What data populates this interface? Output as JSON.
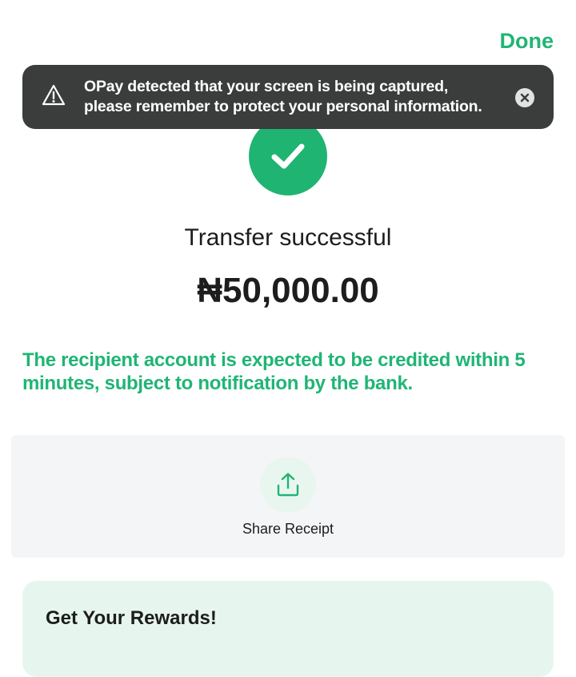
{
  "header": {
    "done_label": "Done"
  },
  "toast": {
    "icon": "warning-triangle-icon",
    "line1": "OPay detected that your screen is being captured,",
    "line2": "please remember to protect your personal information.",
    "close_icon": "close-circle-icon"
  },
  "status": {
    "icon": "checkmark-icon",
    "title": "Transfer successful",
    "amount": "₦50,000.00"
  },
  "notice": {
    "text": "The recipient account is expected to be credited within 5 minutes, subject to notification by the bank."
  },
  "share": {
    "icon": "share-upload-icon",
    "label": "Share Receipt"
  },
  "rewards": {
    "title": "Get Your Rewards!"
  },
  "colors": {
    "brand_green": "#20b575",
    "toast_bg": "#3b3c3c",
    "card_bg": "#f4f5f7",
    "rewards_bg": "#e6f6ee"
  }
}
